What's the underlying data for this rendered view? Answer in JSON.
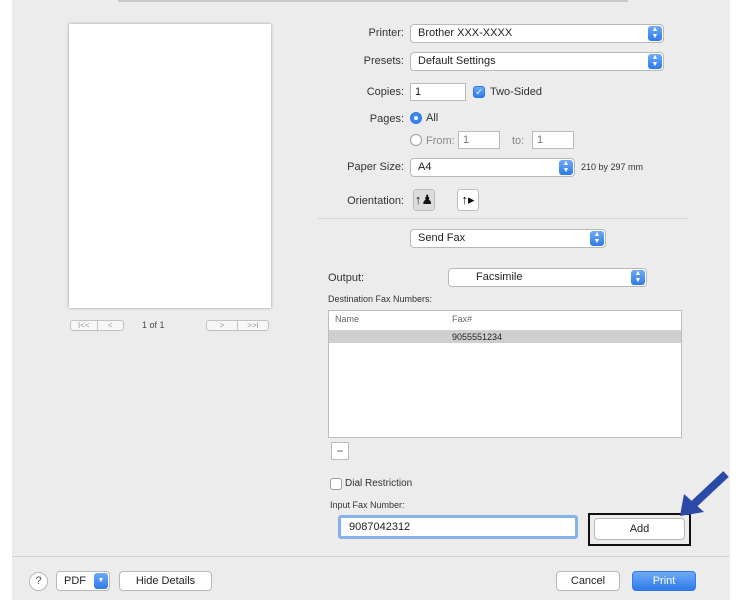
{
  "preview": {
    "page_count": "1 of 1",
    "first_label": "I<<",
    "prev_label": "<",
    "next_label": ">",
    "last_label": ">>I"
  },
  "print_settings": {
    "printer_label": "Printer:",
    "printer_value": "Brother XXX-XXXX",
    "presets_label": "Presets:",
    "presets_value": "Default Settings",
    "copies_label": "Copies:",
    "copies_value": "1",
    "two_sided_label": "Two-Sided",
    "two_sided_checked": true,
    "pages_label": "Pages:",
    "pages_all_label": "All",
    "pages_from_label": "From:",
    "pages_from_value": "1",
    "pages_to_label": "to:",
    "pages_to_value": "1",
    "paper_size_label": "Paper Size:",
    "paper_size_value": "A4",
    "paper_size_dims": "210 by 297 mm",
    "orientation_label": "Orientation:",
    "section_value": "Send Fax"
  },
  "fax": {
    "output_label": "Output:",
    "output_value": "Facsimile",
    "destination_label": "Destination Fax Numbers:",
    "columns": [
      "Name",
      "Fax#"
    ],
    "rows": [
      {
        "name": "",
        "fax": "9055551234"
      }
    ],
    "remove_label": "−",
    "dial_restriction_label": "Dial Restriction",
    "input_label": "Input Fax Number:",
    "input_value": "9087042312",
    "add_label": "Add"
  },
  "footer": {
    "help_label": "?",
    "pdf_label": "PDF",
    "hide_details_label": "Hide Details",
    "cancel_label": "Cancel",
    "print_label": "Print"
  },
  "colors": {
    "accent": "#2f7ae8",
    "annotation_arrow": "#2b4aa8"
  }
}
